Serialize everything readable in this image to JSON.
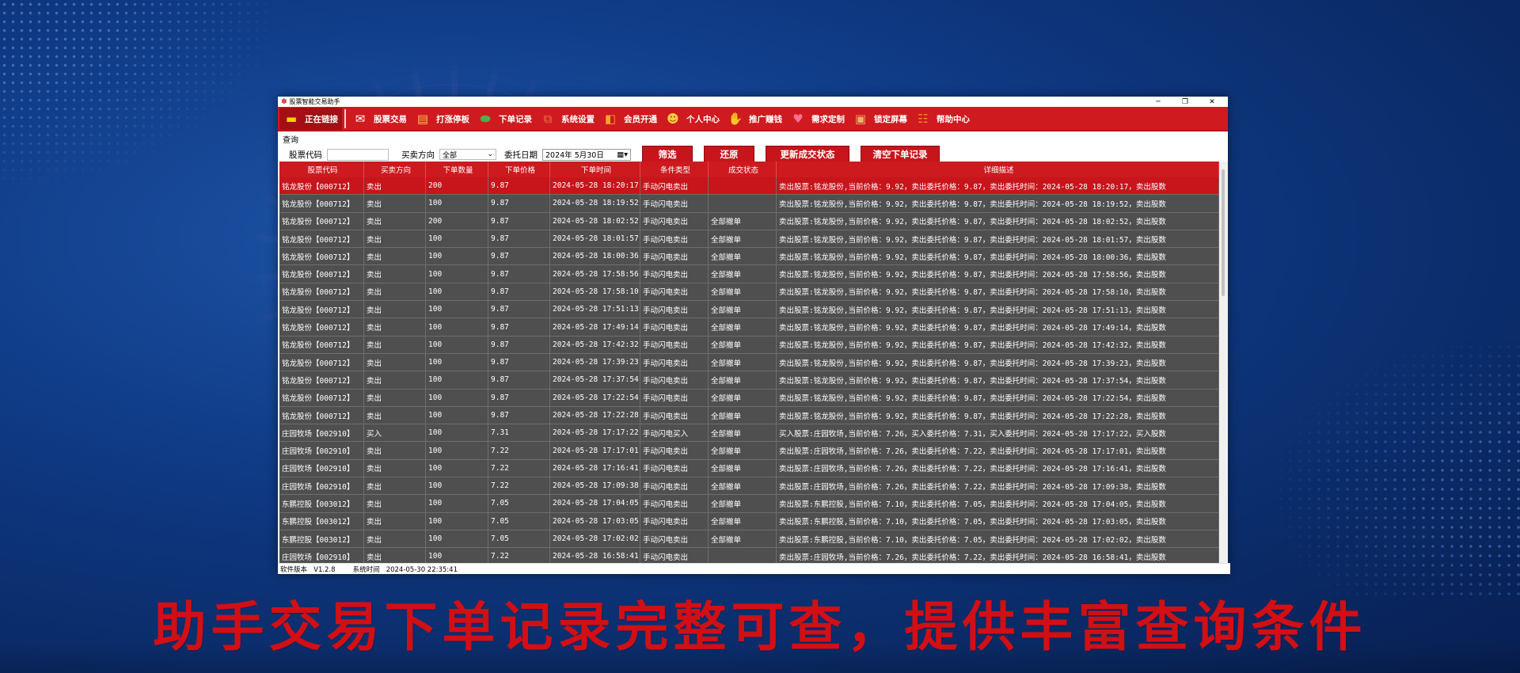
{
  "window": {
    "title": "股票智能交易助手"
  },
  "toolbar": [
    {
      "label": "正在链接",
      "icon": "monitor-icon",
      "color": "#f2d200"
    },
    {
      "label": "股票交易",
      "icon": "sell-buy-icon",
      "color": "#ffffff"
    },
    {
      "label": "打涨停板",
      "icon": "chart-board-icon",
      "color": "#f5c542"
    },
    {
      "label": "下单记录",
      "icon": "instock-icon",
      "color": "#4caf50"
    },
    {
      "label": "系统设置",
      "icon": "toolbox-icon",
      "color": "#e0533a"
    },
    {
      "label": "会员开通",
      "icon": "shopping-bag-icon",
      "color": "#f5a623"
    },
    {
      "label": "个人中心",
      "icon": "person-icon",
      "color": "#f4d03f"
    },
    {
      "label": "推广赚钱",
      "icon": "handshake-icon",
      "color": "#7ed6a0"
    },
    {
      "label": "需求定制",
      "icon": "heart-icon",
      "color": "#ff6f91"
    },
    {
      "label": "锁定屏幕",
      "icon": "box-lock-icon",
      "color": "#e6b566"
    },
    {
      "label": "帮助中心",
      "icon": "help-book-icon",
      "color": "#f08a24"
    }
  ],
  "query": {
    "section_label": "查询",
    "code_label": "股票代码",
    "code_value": "",
    "direction_label": "买卖方向",
    "direction_value": "全部",
    "date_label": "委托日期",
    "date_value": "2024年 5月30日",
    "btn_filter": "筛选",
    "btn_reset": "还原",
    "btn_refresh": "更新成交状态",
    "btn_clear": "清空下单记录"
  },
  "table": {
    "headers": [
      "股票代码",
      "买卖方向",
      "下单数量",
      "下单价格",
      "下单时间",
      "条件类型",
      "成交状态",
      "详细描述"
    ],
    "rows": [
      [
        "铭龙股份【000712】",
        "卖出",
        "200",
        "9.87",
        "2024-05-28 18:20:17",
        "手动闪电卖出",
        "",
        "卖出股票:铭龙股份,当前价格：9.92，卖出委托价格：9.87，卖出委托时间：2024-05-28 18:20:17，卖出股数"
      ],
      [
        "铭龙股份【000712】",
        "卖出",
        "100",
        "9.87",
        "2024-05-28 18:19:52",
        "手动闪电卖出",
        "",
        "卖出股票:铭龙股份,当前价格：9.92，卖出委托价格：9.87，卖出委托时间：2024-05-28 18:19:52，卖出股数"
      ],
      [
        "铭龙股份【000712】",
        "卖出",
        "200",
        "9.87",
        "2024-05-28 18:02:52",
        "手动闪电卖出",
        "全部撤单",
        "卖出股票:铭龙股份,当前价格：9.92，卖出委托价格：9.87，卖出委托时间：2024-05-28 18:02:52，卖出股数"
      ],
      [
        "铭龙股份【000712】",
        "卖出",
        "100",
        "9.87",
        "2024-05-28 18:01:57",
        "手动闪电卖出",
        "全部撤单",
        "卖出股票:铭龙股份,当前价格：9.92，卖出委托价格：9.87，卖出委托时间：2024-05-28 18:01:57，卖出股数"
      ],
      [
        "铭龙股份【000712】",
        "卖出",
        "100",
        "9.87",
        "2024-05-28 18:00:36",
        "手动闪电卖出",
        "全部撤单",
        "卖出股票:铭龙股份,当前价格：9.92，卖出委托价格：9.87，卖出委托时间：2024-05-28 18:00:36，卖出股数"
      ],
      [
        "铭龙股份【000712】",
        "卖出",
        "100",
        "9.87",
        "2024-05-28 17:58:56",
        "手动闪电卖出",
        "全部撤单",
        "卖出股票:铭龙股份,当前价格：9.92，卖出委托价格：9.87，卖出委托时间：2024-05-28 17:58:56，卖出股数"
      ],
      [
        "铭龙股份【000712】",
        "卖出",
        "100",
        "9.87",
        "2024-05-28 17:58:10",
        "手动闪电卖出",
        "全部撤单",
        "卖出股票:铭龙股份,当前价格：9.92，卖出委托价格：9.87，卖出委托时间：2024-05-28 17:58:10，卖出股数"
      ],
      [
        "铭龙股份【000712】",
        "卖出",
        "100",
        "9.87",
        "2024-05-28 17:51:13",
        "手动闪电卖出",
        "全部撤单",
        "卖出股票:铭龙股份,当前价格：9.92，卖出委托价格：9.87，卖出委托时间：2024-05-28 17:51:13，卖出股数"
      ],
      [
        "铭龙股份【000712】",
        "卖出",
        "100",
        "9.87",
        "2024-05-28 17:49:14",
        "手动闪电卖出",
        "全部撤单",
        "卖出股票:铭龙股份,当前价格：9.92，卖出委托价格：9.87，卖出委托时间：2024-05-28 17:49:14，卖出股数"
      ],
      [
        "铭龙股份【000712】",
        "卖出",
        "100",
        "9.87",
        "2024-05-28 17:42:32",
        "手动闪电卖出",
        "全部撤单",
        "卖出股票:铭龙股份,当前价格：9.92，卖出委托价格：9.87，卖出委托时间：2024-05-28 17:42:32，卖出股数"
      ],
      [
        "铭龙股份【000712】",
        "卖出",
        "100",
        "9.87",
        "2024-05-28 17:39:23",
        "手动闪电卖出",
        "全部撤单",
        "卖出股票:铭龙股份,当前价格：9.92，卖出委托价格：9.87，卖出委托时间：2024-05-28 17:39:23，卖出股数"
      ],
      [
        "铭龙股份【000712】",
        "卖出",
        "100",
        "9.87",
        "2024-05-28 17:37:54",
        "手动闪电卖出",
        "全部撤单",
        "卖出股票:铭龙股份,当前价格：9.92，卖出委托价格：9.87，卖出委托时间：2024-05-28 17:37:54，卖出股数"
      ],
      [
        "铭龙股份【000712】",
        "卖出",
        "100",
        "9.87",
        "2024-05-28 17:22:54",
        "手动闪电卖出",
        "全部撤单",
        "卖出股票:铭龙股份,当前价格：9.92，卖出委托价格：9.87，卖出委托时间：2024-05-28 17:22:54，卖出股数"
      ],
      [
        "铭龙股份【000712】",
        "卖出",
        "100",
        "9.87",
        "2024-05-28 17:22:28",
        "手动闪电卖出",
        "全部撤单",
        "卖出股票:铭龙股份,当前价格：9.92，卖出委托价格：9.87，卖出委托时间：2024-05-28 17:22:28，卖出股数"
      ],
      [
        "庄园牧场【002910】",
        "买入",
        "100",
        "7.31",
        "2024-05-28 17:17:22",
        "手动闪电买入",
        "全部撤单",
        "买入股票:庄园牧场,当前价格：7.26，买入委托价格：7.31，买入委托时间：2024-05-28 17:17:22，买入股数"
      ],
      [
        "庄园牧场【002910】",
        "卖出",
        "100",
        "7.22",
        "2024-05-28 17:17:01",
        "手动闪电卖出",
        "全部撤单",
        "卖出股票:庄园牧场,当前价格：7.26，卖出委托价格：7.22，卖出委托时间：2024-05-28 17:17:01，卖出股数"
      ],
      [
        "庄园牧场【002910】",
        "卖出",
        "100",
        "7.22",
        "2024-05-28 17:16:41",
        "手动闪电卖出",
        "全部撤单",
        "卖出股票:庄园牧场,当前价格：7.26，卖出委托价格：7.22，卖出委托时间：2024-05-28 17:16:41，卖出股数"
      ],
      [
        "庄园牧场【002910】",
        "卖出",
        "100",
        "7.22",
        "2024-05-28 17:09:38",
        "手动闪电卖出",
        "全部撤单",
        "卖出股票:庄园牧场,当前价格：7.26，卖出委托价格：7.22，卖出委托时间：2024-05-28 17:09:38，卖出股数"
      ],
      [
        "东鹏控股【003012】",
        "卖出",
        "100",
        "7.05",
        "2024-05-28 17:04:05",
        "手动闪电卖出",
        "全部撤单",
        "卖出股票:东鹏控股,当前价格：7.10，卖出委托价格：7.05，卖出委托时间：2024-05-28 17:04:05，卖出股数"
      ],
      [
        "东鹏控股【003012】",
        "卖出",
        "100",
        "7.05",
        "2024-05-28 17:03:05",
        "手动闪电卖出",
        "全部撤单",
        "卖出股票:东鹏控股,当前价格：7.10，卖出委托价格：7.05，卖出委托时间：2024-05-28 17:03:05，卖出股数"
      ],
      [
        "东鹏控股【003012】",
        "卖出",
        "100",
        "7.05",
        "2024-05-28 17:02:02",
        "手动闪电卖出",
        "全部撤单",
        "卖出股票:东鹏控股,当前价格：7.10，卖出委托价格：7.05，卖出委托时间：2024-05-28 17:02:02，卖出股数"
      ],
      [
        "庄园牧场【002910】",
        "卖出",
        "100",
        "7.22",
        "2024-05-28 16:58:41",
        "手动闪电卖出",
        "",
        "卖出股票:庄园牧场,当前价格：7.26，卖出委托价格：7.22，卖出委托时间：2024-05-28 16:58:41，卖出股数"
      ]
    ],
    "selected_row": 0
  },
  "status": {
    "version_label": "软件版本",
    "version_value": "V1.2.8",
    "time_label": "系统时间",
    "time_value": "2024-05-30 22:35:41"
  },
  "slogan": "助手交易下单记录完整可查，提供丰富查询条件",
  "colors": {
    "brand_red": "#cf1a1f",
    "grid_bg": "#4f4f4f",
    "selected_row": "#c8141b"
  }
}
